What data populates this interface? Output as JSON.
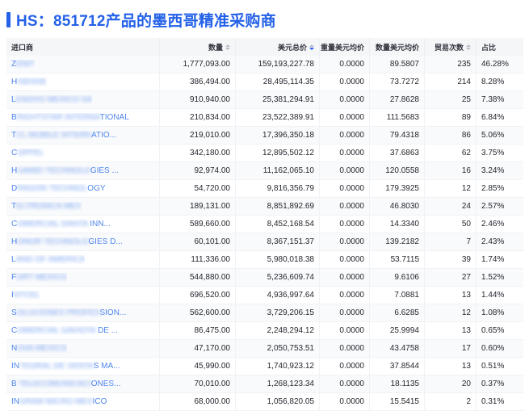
{
  "title": "HS：851712产品的墨西哥精准采购商",
  "colors": {
    "accent_blue": "#2461e8",
    "link_blue": "#4f86ec",
    "header_bg": "#f5f6f8",
    "active_sort": "#2461e8"
  },
  "table": {
    "columns": [
      {
        "key": "importer",
        "label": "进口商",
        "sortable": false,
        "sort": ""
      },
      {
        "key": "qty",
        "label": "数量",
        "sortable": true,
        "sort": ""
      },
      {
        "key": "usd_total",
        "label": "美元总价",
        "sortable": true,
        "sort": "desc"
      },
      {
        "key": "weight_avg",
        "label": "重量美元均价",
        "sortable": false,
        "sort": ""
      },
      {
        "key": "qty_avg",
        "label": "数量美元均价",
        "sortable": false,
        "sort": ""
      },
      {
        "key": "trade_count",
        "label": "贸易次数",
        "sortable": true,
        "sort": ""
      },
      {
        "key": "share",
        "label": "占比",
        "sortable": false,
        "sort": ""
      }
    ],
    "rows": [
      {
        "importer": {
          "head": "Z",
          "masked": "ENIT",
          "tail": ""
        },
        "qty": "1,777,093.00",
        "usd_total": "159,193,227.78",
        "weight_avg": "0.0000",
        "qty_avg": "89.5807",
        "trade_count": "235",
        "share": "46.28%"
      },
      {
        "importer": {
          "head": "H",
          "masked": "ISENSE",
          "tail": ""
        },
        "qty": "386,494.00",
        "usd_total": "28,495,114.35",
        "weight_avg": "0.0000",
        "qty_avg": "73.7272",
        "trade_count": "214",
        "share": "8.28%"
      },
      {
        "importer": {
          "head": "L",
          "masked": "ENOVO MEXICO SA",
          "tail": ""
        },
        "qty": "910,940.00",
        "usd_total": "25,381,294.91",
        "weight_avg": "0.0000",
        "qty_avg": "27.8628",
        "trade_count": "25",
        "share": "7.38%"
      },
      {
        "importer": {
          "head": "B",
          "masked": "RIGHTSTAR INTERNA",
          "tail": "TIONAL"
        },
        "qty": "210,834.00",
        "usd_total": "23,522,389.91",
        "weight_avg": "0.0000",
        "qty_avg": "111.5683",
        "trade_count": "89",
        "share": "6.84%"
      },
      {
        "importer": {
          "head": "T",
          "masked": "CL MOBILE INTERN",
          "tail": "ATIO..."
        },
        "qty": "219,010.00",
        "usd_total": "17,396,350.18",
        "weight_avg": "0.0000",
        "qty_avg": "79.4318",
        "trade_count": "86",
        "share": "5.06%"
      },
      {
        "importer": {
          "head": "C",
          "masked": "OPPEL",
          "tail": ""
        },
        "qty": "342,180.00",
        "usd_total": "12,895,502.12",
        "weight_avg": "0.0000",
        "qty_avg": "37.6863",
        "trade_count": "62",
        "share": "3.75%"
      },
      {
        "importer": {
          "head": "H",
          "masked": "UAWEI TECHNOLO",
          "tail": "GIES ..."
        },
        "qty": "92,974.00",
        "usd_total": "11,162,065.10",
        "weight_avg": "0.0000",
        "qty_avg": "120.0558",
        "trade_count": "16",
        "share": "3.24%"
      },
      {
        "importer": {
          "head": "D",
          "masked": "RAGON TECHNOL",
          "tail": "OGY"
        },
        "qty": "54,720.00",
        "usd_total": "9,816,356.79",
        "weight_avg": "0.0000",
        "qty_avg": "179.3925",
        "trade_count": "12",
        "share": "2.85%"
      },
      {
        "importer": {
          "head": "T",
          "masked": "ELTRONICA MEX",
          "tail": ""
        },
        "qty": "189,131.00",
        "usd_total": "8,851,892.69",
        "weight_avg": "0.0000",
        "qty_avg": "46.8030",
        "trade_count": "24",
        "share": "2.57%"
      },
      {
        "importer": {
          "head": "C",
          "masked": "OMERCIAL DANTA",
          "tail": " INN..."
        },
        "qty": "589,660.00",
        "usd_total": "8,452,168.54",
        "weight_avg": "0.0000",
        "qty_avg": "14.3340",
        "trade_count": "50",
        "share": "2.46%"
      },
      {
        "importer": {
          "head": "H",
          "masked": "ONOR TECHNOLO",
          "tail": "GIES D..."
        },
        "qty": "60,101.00",
        "usd_total": "8,367,151.37",
        "weight_avg": "0.0000",
        "qty_avg": "139.2182",
        "trade_count": "7",
        "share": "2.43%"
      },
      {
        "importer": {
          "head": "L",
          "masked": "AND OF AMERICA",
          "tail": ""
        },
        "qty": "111,336.00",
        "usd_total": "5,980,018.38",
        "weight_avg": "0.0000",
        "qty_avg": "53.7115",
        "trade_count": "39",
        "share": "1.74%"
      },
      {
        "importer": {
          "head": "F",
          "masked": "ORT MEXICO",
          "tail": ""
        },
        "qty": "544,880.00",
        "usd_total": "5,236,609.74",
        "weight_avg": "0.0000",
        "qty_avg": "9.6106",
        "trade_count": "27",
        "share": "1.52%"
      },
      {
        "importer": {
          "head": "I",
          "masked": "NTCEL",
          "tail": ""
        },
        "qty": "696,520.00",
        "usd_total": "4,936,997.64",
        "weight_avg": "0.0000",
        "qty_avg": "7.0881",
        "trade_count": "13",
        "share": "1.44%"
      },
      {
        "importer": {
          "head": "S",
          "masked": "OLUCIONES PROFES",
          "tail": "SION..."
        },
        "qty": "562,600.00",
        "usd_total": "3,729,206.15",
        "weight_avg": "0.0000",
        "qty_avg": "6.6285",
        "trade_count": "12",
        "share": "1.08%"
      },
      {
        "importer": {
          "head": "C",
          "masked": "OMERCIAL GAVIOTA",
          "tail": " DE ..."
        },
        "qty": "86,475.00",
        "usd_total": "2,248,294.12",
        "weight_avg": "0.0000",
        "qty_avg": "25.9994",
        "trade_count": "13",
        "share": "0.65%"
      },
      {
        "importer": {
          "head": "N",
          "masked": "OVA MEXICO",
          "tail": ""
        },
        "qty": "47,170.00",
        "usd_total": "2,050,753.51",
        "weight_avg": "0.0000",
        "qty_avg": "43.4758",
        "trade_count": "17",
        "share": "0.60%"
      },
      {
        "importer": {
          "head": "IN",
          "masked": "TEGRAL DE VENTA",
          "tail": "S MA..."
        },
        "qty": "45,990.00",
        "usd_total": "1,740,923.12",
        "weight_avg": "0.0000",
        "qty_avg": "37.8544",
        "trade_count": "13",
        "share": "0.51%"
      },
      {
        "importer": {
          "head": "B",
          "masked": " TELECOMUNICACI",
          "tail": "ONES..."
        },
        "qty": "70,010.00",
        "usd_total": "1,268,123.34",
        "weight_avg": "0.0000",
        "qty_avg": "18.1135",
        "trade_count": "20",
        "share": "0.37%"
      },
      {
        "importer": {
          "head": "IN",
          "masked": "GRAM MICRO MEX",
          "tail": "ICO"
        },
        "qty": "68,000.00",
        "usd_total": "1,056,820.05",
        "weight_avg": "0.0000",
        "qty_avg": "15.5415",
        "trade_count": "2",
        "share": "0.31%"
      }
    ]
  }
}
